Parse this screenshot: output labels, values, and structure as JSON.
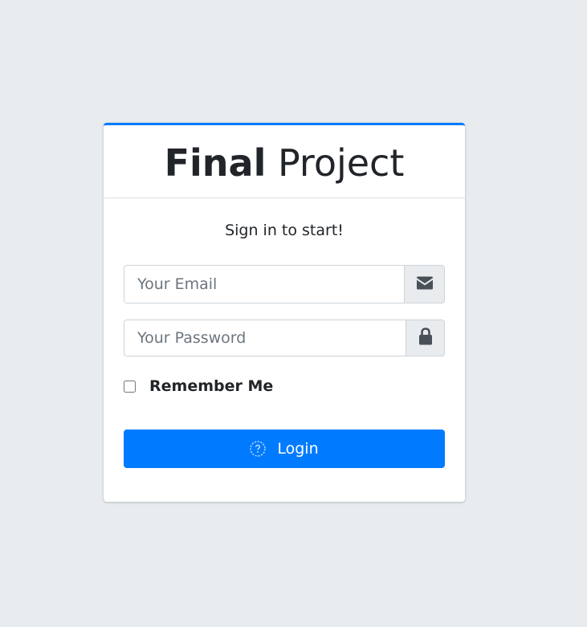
{
  "brand": {
    "bold": "Final",
    "regular": " Project"
  },
  "login": {
    "message": "Sign in to start!",
    "email": {
      "placeholder": "Your Email",
      "value": "",
      "icon": "envelope-icon"
    },
    "password": {
      "placeholder": "Your Password",
      "value": "",
      "icon": "lock-icon"
    },
    "remember": {
      "label": "Remember Me",
      "checked": false
    },
    "button": {
      "label": "Login",
      "icon": "question-circle-icon"
    }
  },
  "colors": {
    "background": "#e9ecef",
    "accent": "#007bff",
    "card": "#ffffff",
    "addon": "#e9ecef"
  }
}
